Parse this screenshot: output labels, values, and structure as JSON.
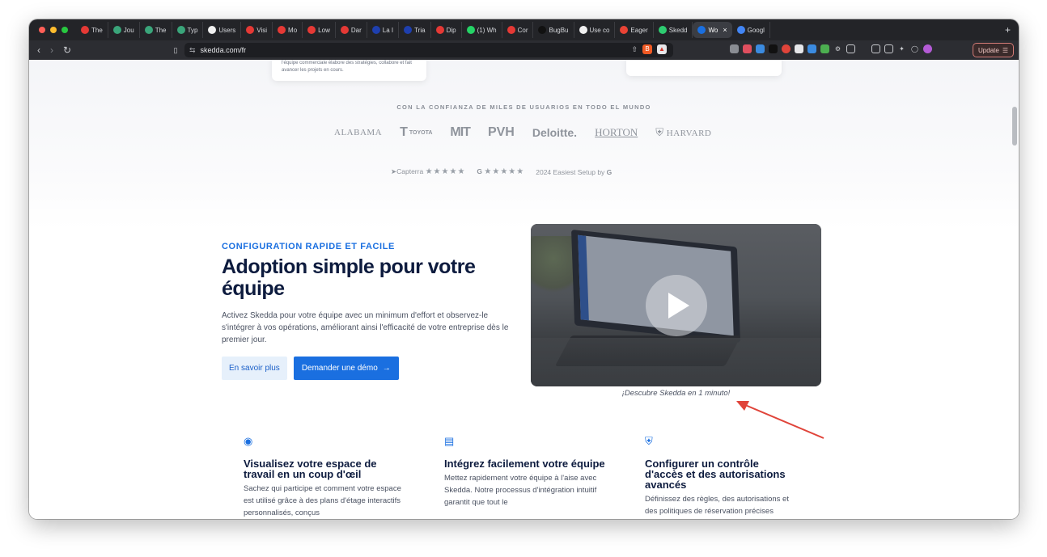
{
  "browser": {
    "tabs": [
      {
        "label": "The",
        "icon": "youtube-icon",
        "color": "#e53935"
      },
      {
        "label": "Jou",
        "icon": "chatgpt-icon",
        "color": "#3aa57a"
      },
      {
        "label": "The",
        "icon": "chatgpt-icon",
        "color": "#3aa57a"
      },
      {
        "label": "Typ",
        "icon": "chatgpt-icon",
        "color": "#3aa57a"
      },
      {
        "label": "Users",
        "icon": "github-icon",
        "color": "#f0f0f0"
      },
      {
        "label": "Visi",
        "icon": "youtube-icon",
        "color": "#e53935"
      },
      {
        "label": "Mo",
        "icon": "flag-icon",
        "color": "#e53935"
      },
      {
        "label": "Low",
        "icon": "youtube-icon",
        "color": "#e53935"
      },
      {
        "label": "Dar",
        "icon": "youtube-icon",
        "color": "#e53935"
      },
      {
        "label": "La I",
        "icon": "flag-icon",
        "color": "#1e3fae"
      },
      {
        "label": "Tria",
        "icon": "flag-icon",
        "color": "#1e3fae"
      },
      {
        "label": "Dip",
        "icon": "youtube-icon",
        "color": "#e53935"
      },
      {
        "label": "(1) Wh",
        "icon": "whatsapp-icon",
        "color": "#25d366"
      },
      {
        "label": "Cor",
        "icon": "youtube-icon",
        "color": "#e53935"
      },
      {
        "label": "BugBu",
        "icon": "bugbug-icon",
        "color": "#111111"
      },
      {
        "label": "Use co",
        "icon": "github-icon",
        "color": "#f0f0f0"
      },
      {
        "label": "Eager",
        "icon": "gmail-icon",
        "color": "#ea4335"
      },
      {
        "label": "Skedd",
        "icon": "skedda-icon",
        "color": "#2ecc71"
      },
      {
        "label": "Wo",
        "icon": "skedda-icon",
        "color": "#1a6fe0",
        "active": true
      },
      {
        "label": "Googl",
        "icon": "google-calendar-icon",
        "color": "#4285f4"
      }
    ],
    "new_tab": "+",
    "url": "skedda.com/fr",
    "update_label": "Update"
  },
  "top_card": {
    "text": "l'équipe commerciale élabore des stratégies, collabore et fait avancer les projets en cours."
  },
  "trust": {
    "heading": "CON LA CONFIANZA DE MILES DE USUARIOS EN TODO EL MUNDO",
    "logos": [
      "ALABAMA",
      "TOYOTA",
      "MIT",
      "PVH",
      "Deloitte.",
      "HORTON",
      "HARVARD"
    ],
    "capterra_label": "Capterra",
    "award_label": "2024 Easiest Setup by",
    "stars": "★★★★★"
  },
  "feature": {
    "eyebrow": "CONFIGURATION RAPIDE ET FACILE",
    "headline": "Adoption simple pour votre équipe",
    "description": "Activez Skedda pour votre équipe avec un minimum d'effort et observez-le s'intégrer à vos opérations, améliorant ainsi l'efficacité de votre entreprise dès le premier jour.",
    "learn_more_label": "En savoir plus",
    "demo_label": "Demander une démo",
    "video_caption": "¡Descubre Skedda en 1 minuto!"
  },
  "features": [
    {
      "icon": "map-pin-icon",
      "title": "Visualisez votre espace de travail en un coup d'œil",
      "text": "Sachez qui participe et comment votre espace est utilisé grâce à des plans d'étage interactifs personnalisés, conçus"
    },
    {
      "icon": "books-icon",
      "title": "Intégrez facilement votre équipe",
      "text": "Mettez rapidement votre équipe à l'aise avec Skedda. Notre processus d'intégration intuitif garantit que tout le"
    },
    {
      "icon": "shield-icon",
      "title": "Configurer un contrôle d'accès et des autorisations avancés",
      "text": "Définissez des règles, des autorisations et des politiques de réservation précises"
    }
  ],
  "colors": {
    "brand_blue": "#1a6fe0",
    "headline_navy": "#0d1b3e",
    "annotation_red": "#e0443a"
  }
}
